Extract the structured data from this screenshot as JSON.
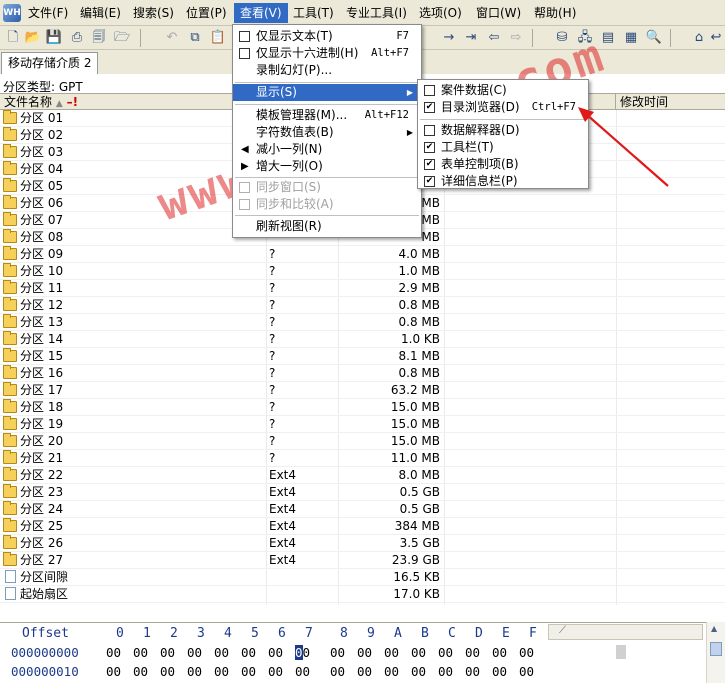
{
  "menubar": {
    "items": [
      "文件(F)",
      "编辑(E)",
      "搜索(S)",
      "位置(P)",
      "查看(V)",
      "工具(T)",
      "专业工具(I)",
      "选项(O)",
      "窗口(W)",
      "帮助(H)"
    ]
  },
  "tabs": [
    {
      "label": "移动存储介质 2"
    }
  ],
  "partition_type": "分区类型: GPT",
  "columns": {
    "name": "文件名称",
    "modified": "修改时间"
  },
  "rows": [
    {
      "name": "分区 01",
      "type": "",
      "size": ""
    },
    {
      "name": "分区 02",
      "type": "",
      "size": ""
    },
    {
      "name": "分区 03",
      "type": "",
      "size": ""
    },
    {
      "name": "分区 04",
      "type": "",
      "size": ""
    },
    {
      "name": "分区 05",
      "type": "",
      "size": ""
    },
    {
      "name": "分区 06",
      "type": "",
      "size": "MB"
    },
    {
      "name": "分区 07",
      "type": "",
      "size": "MB"
    },
    {
      "name": "分区 08",
      "type": "",
      "size": "MB"
    },
    {
      "name": "分区 09",
      "type": "?",
      "size": "4.0 MB"
    },
    {
      "name": "分区 10",
      "type": "?",
      "size": "1.0 MB"
    },
    {
      "name": "分区 11",
      "type": "?",
      "size": "2.9 MB"
    },
    {
      "name": "分区 12",
      "type": "?",
      "size": "0.8 MB"
    },
    {
      "name": "分区 13",
      "type": "?",
      "size": "0.8 MB"
    },
    {
      "name": "分区 14",
      "type": "?",
      "size": "1.0 KB"
    },
    {
      "name": "分区 15",
      "type": "?",
      "size": "8.1 MB"
    },
    {
      "name": "分区 16",
      "type": "?",
      "size": "0.8 MB"
    },
    {
      "name": "分区 17",
      "type": "?",
      "size": "63.2 MB"
    },
    {
      "name": "分区 18",
      "type": "?",
      "size": "15.0 MB"
    },
    {
      "name": "分区 19",
      "type": "?",
      "size": "15.0 MB"
    },
    {
      "name": "分区 20",
      "type": "?",
      "size": "15.0 MB"
    },
    {
      "name": "分区 21",
      "type": "?",
      "size": "11.0 MB"
    },
    {
      "name": "分区 22",
      "type": "Ext4",
      "size": "8.0 MB"
    },
    {
      "name": "分区 23",
      "type": "Ext4",
      "size": "0.5 GB"
    },
    {
      "name": "分区 24",
      "type": "Ext4",
      "size": "0.5 GB"
    },
    {
      "name": "分区 25",
      "type": "Ext4",
      "size": "384 MB"
    },
    {
      "name": "分区 26",
      "type": "Ext4",
      "size": "3.5 GB"
    },
    {
      "name": "分区 27",
      "type": "Ext4",
      "size": "23.9 GB"
    },
    {
      "name": "分区间隙",
      "type": "",
      "size": "16.5 KB",
      "file": true
    },
    {
      "name": "起始扇区",
      "type": "",
      "size": "17.0 KB",
      "file": true
    }
  ],
  "hex": {
    "offset_label": "Offset",
    "columns": [
      "0",
      "1",
      "2",
      "3",
      "4",
      "5",
      "6",
      "7",
      "8",
      "9",
      "A",
      "B",
      "C",
      "D",
      "E",
      "F"
    ],
    "rows": [
      {
        "offset": "000000000",
        "bytes": [
          "00",
          "00",
          "00",
          "00",
          "00",
          "00",
          "00",
          "00",
          "00",
          "00",
          "00",
          "00",
          "00",
          "00",
          "00",
          "00"
        ]
      },
      {
        "offset": "000000010",
        "bytes": [
          "00",
          "00",
          "00",
          "00",
          "00",
          "00",
          "00",
          "00",
          "00",
          "00",
          "00",
          "00",
          "00",
          "00",
          "00",
          "00"
        ]
      }
    ]
  },
  "view_menu": {
    "text_only": {
      "label": "仅显示文本(T)",
      "shortcut": "F7"
    },
    "hex_only": {
      "label": "仅显示十六进制(H)",
      "shortcut": "Alt+F7"
    },
    "slideshow": {
      "label": "录制幻灯(P)..."
    },
    "display": {
      "label": "显示(S)"
    },
    "template_manager": {
      "label": "模板管理器(M)...",
      "shortcut": "Alt+F12"
    },
    "charset_table": {
      "label": "字符数值表(B)"
    },
    "decrease_column": {
      "label": "减小一列(N)"
    },
    "increase_column": {
      "label": "增大一列(O)"
    },
    "sync_window": {
      "label": "同步窗口(S)"
    },
    "sync_compare": {
      "label": "同步和比较(A)"
    },
    "refresh": {
      "label": "刷新视图(R)"
    }
  },
  "display_submenu": {
    "case_data": {
      "label": "案件数据(C)",
      "checked": false
    },
    "dir_browser": {
      "label": "目录浏览器(D)",
      "shortcut": "Ctrl+F7",
      "checked": true
    },
    "data_interpreter": {
      "label": "数据解释器(D)",
      "checked": false
    },
    "toolbar": {
      "label": "工具栏(T)",
      "checked": true
    },
    "form_controls": {
      "label": "表单控制项(B)",
      "checked": true
    },
    "details_bar": {
      "label": "详细信息栏(P)",
      "checked": true
    }
  },
  "watermark": "www.mike-dz.com",
  "colors": {
    "highlight": "#316ac5",
    "watermark": "#de2828",
    "arrow": "#e01818"
  }
}
